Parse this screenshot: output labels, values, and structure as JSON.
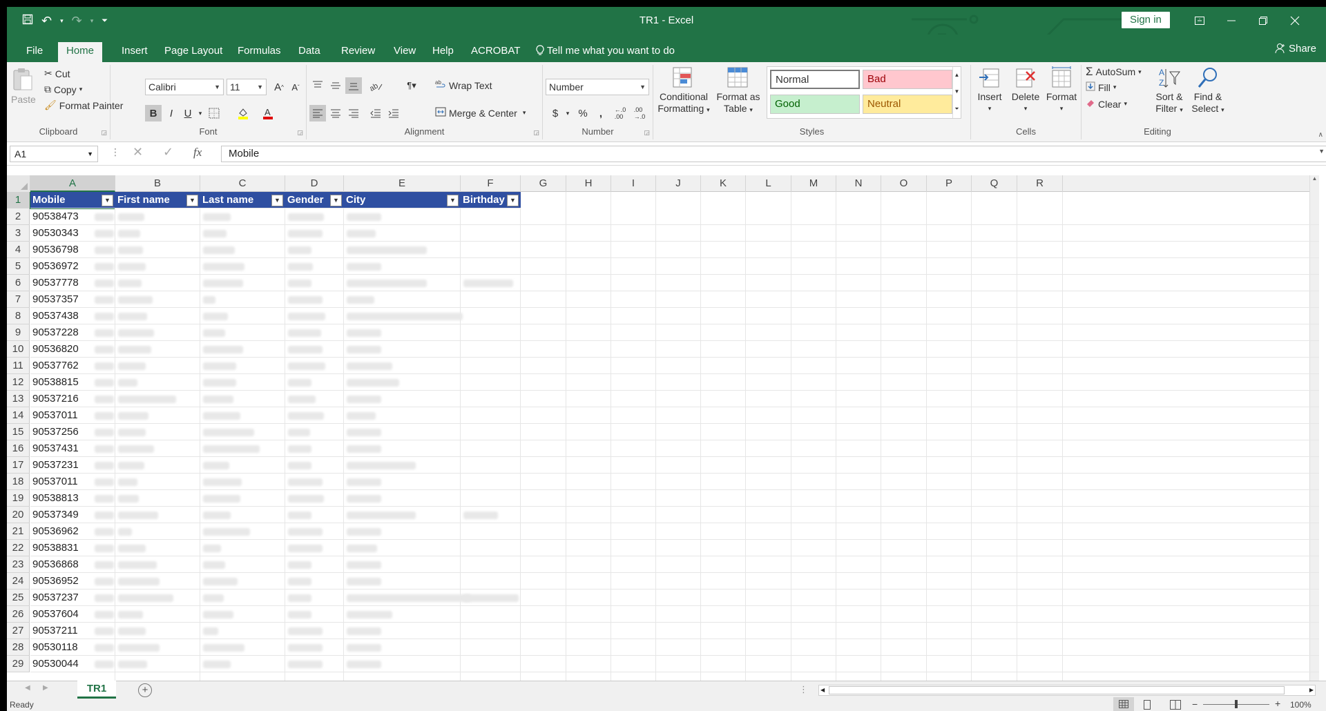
{
  "window": {
    "title": "TR1  -  Excel",
    "sign_in": "Sign in"
  },
  "menu": {
    "tabs": [
      "File",
      "Home",
      "Insert",
      "Page Layout",
      "Formulas",
      "Data",
      "Review",
      "View",
      "Help",
      "ACROBAT"
    ],
    "active_tab": "Home",
    "tell_me": "Tell me what you want to do",
    "share": "Share"
  },
  "ribbon": {
    "clipboard": {
      "label": "Clipboard",
      "paste": "Paste",
      "cut": "Cut",
      "copy": "Copy",
      "format_painter": "Format Painter"
    },
    "font": {
      "label": "Font",
      "name": "Calibri",
      "size": "11",
      "bold": "B",
      "italic": "I",
      "underline": "U"
    },
    "alignment": {
      "label": "Alignment",
      "wrap_text": "Wrap Text",
      "merge_center": "Merge & Center"
    },
    "number": {
      "label": "Number",
      "format": "Number",
      "currency": "$",
      "percent": "%",
      "comma": ","
    },
    "styles": {
      "label": "Styles",
      "conditional_1": "Conditional",
      "conditional_2": "Formatting",
      "format_table_1": "Format as",
      "format_table_2": "Table",
      "normal": "Normal",
      "bad": "Bad",
      "good": "Good",
      "neutral": "Neutral"
    },
    "cells": {
      "label": "Cells",
      "insert": "Insert",
      "delete": "Delete",
      "format": "Format"
    },
    "editing": {
      "label": "Editing",
      "autosum": "AutoSum",
      "fill": "Fill",
      "clear": "Clear",
      "sort_1": "Sort &",
      "sort_2": "Filter",
      "find_1": "Find &",
      "find_2": "Select"
    }
  },
  "formula_bar": {
    "name_box": "A1",
    "fx": "fx",
    "content": "Mobile"
  },
  "grid": {
    "columns": [
      "A",
      "B",
      "C",
      "D",
      "E",
      "F",
      "G",
      "H",
      "I",
      "J",
      "K",
      "L",
      "M",
      "N",
      "O",
      "P",
      "Q",
      "R"
    ],
    "selected_column": "A",
    "headers": [
      "Mobile",
      "First name",
      "Last name",
      "Gender",
      "City",
      "Birthday"
    ],
    "rows": [
      "1",
      "2",
      "3",
      "4",
      "5",
      "6",
      "7",
      "8",
      "9",
      "10",
      "11",
      "12",
      "13",
      "14",
      "15",
      "16",
      "17",
      "18",
      "19",
      "20",
      "21",
      "22",
      "23",
      "24",
      "25",
      "26",
      "27",
      "28",
      "29"
    ],
    "mobile_values": [
      "90538473",
      "90530343",
      "90536798",
      "90536972",
      "90537778",
      "90537357",
      "90537438",
      "90537228",
      "90536820",
      "90537762",
      "90538815",
      "90537216",
      "90537011",
      "90537256",
      "90537431",
      "90537231",
      "90537011",
      "90538813",
      "90537349",
      "90536962",
      "90538831",
      "90536868",
      "90536952",
      "90537237",
      "90537604",
      "90537211",
      "90530118",
      "90530044"
    ]
  },
  "sheets": {
    "tabs": [
      "TR1"
    ],
    "active": "TR1"
  },
  "status": {
    "ready": "Ready",
    "zoom": "100%"
  },
  "colors": {
    "excel_green": "#217346",
    "table_header": "#2f4fa1",
    "bad_bg": "#ffc7ce",
    "good_bg": "#c6efce",
    "neutral_bg": "#ffeb9c"
  }
}
